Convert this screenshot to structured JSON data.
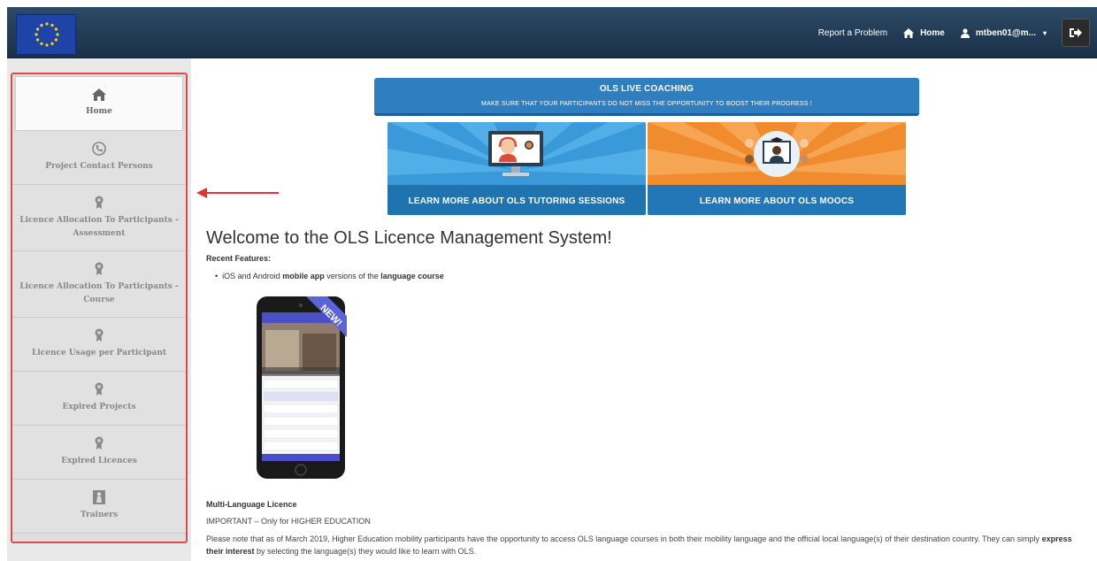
{
  "header": {
    "report_label": "Report a Problem",
    "home_label": "Home",
    "user_label": "mtben01@m...",
    "caret": "▾"
  },
  "sidebar": {
    "items": [
      {
        "label": "Home",
        "icon": "home-icon"
      },
      {
        "label": "Project Contact Persons",
        "icon": "phone-circle-icon"
      },
      {
        "label": "Licence Allocation To Participants - Assessment",
        "icon": "award-icon"
      },
      {
        "label": "Licence Allocation To Participants - Course",
        "icon": "award-icon"
      },
      {
        "label": "Licence Usage per Participant",
        "icon": "award-icon"
      },
      {
        "label": "Expired Projects",
        "icon": "award-icon"
      },
      {
        "label": "Expired Licences",
        "icon": "award-icon"
      },
      {
        "label": "Trainers",
        "icon": "trainer-icon"
      }
    ]
  },
  "banner": {
    "title": "OLS LIVE COACHING",
    "subtitle": "MAKE SURE THAT YOUR PARTICIPANTS DO NOT MISS THE OPPORTUNITY TO BOOST THEIR PROGRESS !"
  },
  "promos": {
    "tutoring": "LEARN MORE ABOUT OLS TUTORING SESSIONS",
    "moocs": "LEARN MORE ABOUT OLS MOOCS"
  },
  "main": {
    "welcome": "Welcome to the OLS Licence Management System!",
    "recent_features": "Recent Features:",
    "bullet_pre": "iOS and Android ",
    "bullet_b1": "mobile app",
    "bullet_mid": " versions of the ",
    "bullet_b2": "language course",
    "new_badge": "NEW!",
    "ml_title": "Multi-Language Licence",
    "ml_important": "IMPORTANT – Only for HIGHER EDUCATION",
    "ml_note_1": "Please note that as of March 2019, Higher Education mobility participants have the opportunity to access OLS language courses in both their mobility language and the official local language(s) of their destination country. They can simply ",
    "ml_note_b1": "express",
    "ml_note_b2": "their interest",
    "ml_note_2": " by selecting the language(s) they would like to learn with OLS."
  },
  "colors": {
    "header": "#1f3a55",
    "highlight_border": "#e04a4a",
    "banner_blue": "#2f7ec0",
    "promo_blue": "#3a9ad9",
    "promo_orange": "#f08c2e"
  }
}
